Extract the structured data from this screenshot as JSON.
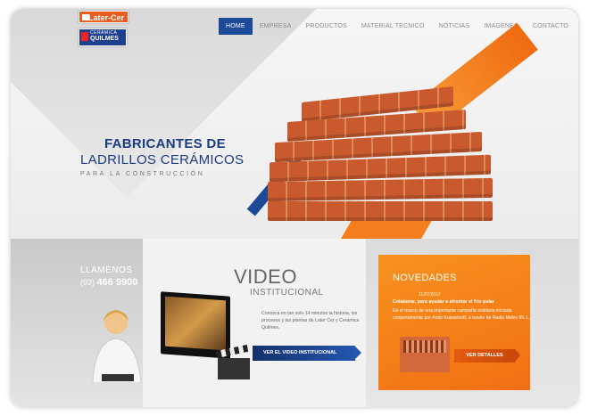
{
  "brand": {
    "logo_primary": "Later-Cer",
    "logo_secondary_small": "CERÁMICA",
    "logo_secondary_big": "QUILMES"
  },
  "nav": {
    "items": [
      {
        "label": "HOME",
        "active": true
      },
      {
        "label": "EMPRESA",
        "active": false
      },
      {
        "label": "PRODUCTOS",
        "active": false
      },
      {
        "label": "MATERIAL TECNICO",
        "active": false
      },
      {
        "label": "NOTICIAS",
        "active": false
      },
      {
        "label": "IMAGENES",
        "active": false
      },
      {
        "label": "CONTACTO",
        "active": false
      }
    ]
  },
  "hero": {
    "line1": "FABRICANTES DE",
    "line2": "LADRILLOS CERÁMICOS",
    "line3": "PARA LA CONSTRUCCIÓN"
  },
  "contact": {
    "label": "LLAMENOS",
    "prefix": "(03)",
    "number": "466 9900"
  },
  "video": {
    "title": "VIDEO",
    "subtitle": "INSTITUCIONAL",
    "text": "Conozca en tan solo 14 minutos la historia, los procesos y las plantas de Later Cer y Ceramica Quilmes.",
    "button": "VER EL VIDEO INSTITUCIONAL"
  },
  "novedades": {
    "title": "NOVEDADES",
    "date": "11/07/2012",
    "headline": "Colaborar, para ayudar a afrontar el frío polar",
    "text": "En el marco de una importante campaña solidaria iniciada conjuntamente por Andy Kusnetzoff, a través de Radio Metro 95.1...",
    "button": "VER DETALLES"
  },
  "colors": {
    "brand_blue": "#1c4a97",
    "accent_orange": "#f47e1e",
    "brick": "#c85a2e"
  }
}
